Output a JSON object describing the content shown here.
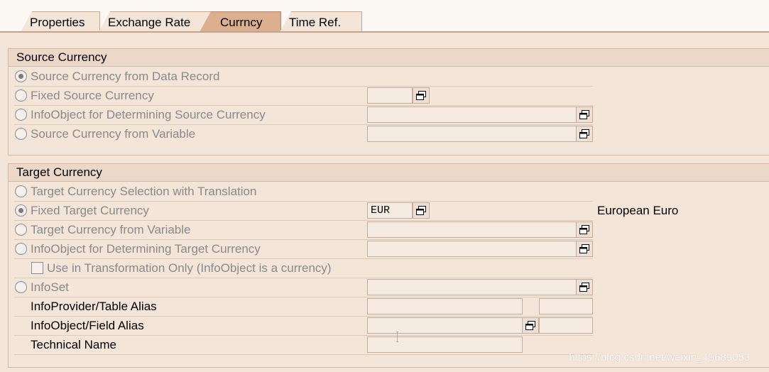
{
  "tabs": [
    {
      "label": "Properties"
    },
    {
      "label": "Exchange Rate"
    },
    {
      "label": "Currncy",
      "active": true
    },
    {
      "label": "Time Ref."
    }
  ],
  "source_currency": {
    "title": "Source Currency",
    "options": [
      {
        "label": "Source Currency from Data Record",
        "selected": true
      },
      {
        "label": "Fixed Source Currency",
        "selected": false,
        "value": ""
      },
      {
        "label": "InfoObject for Determining Source Currency",
        "selected": false,
        "value": ""
      },
      {
        "label": "Source Currency from Variable",
        "selected": false,
        "value": ""
      }
    ]
  },
  "target_currency": {
    "title": "Target Currency",
    "options": [
      {
        "label": "Target Currency Selection with Translation",
        "selected": false
      },
      {
        "label": "Fixed Target Currency",
        "selected": true,
        "value": "EUR",
        "description": "European Euro"
      },
      {
        "label": "Target Currency from Variable",
        "selected": false,
        "value": ""
      },
      {
        "label": "InfoObject for Determining Target Currency",
        "selected": false,
        "value": ""
      }
    ],
    "use_in_transformation": {
      "label": "Use in Transformation Only (InfoObject is a currency)",
      "checked": false
    },
    "infoset": {
      "label": "InfoSet",
      "selected": false,
      "value": ""
    },
    "infoprovider_alias": {
      "label": "InfoProvider/Table Alias",
      "value": "",
      "value2": ""
    },
    "infoobject_alias": {
      "label": "InfoObject/Field Alias",
      "value": "",
      "value2": ""
    },
    "technical_name": {
      "label": "Technical Name",
      "value": ""
    }
  },
  "icons": {
    "value_help": "value-help-icon"
  },
  "colors": {
    "background": "#f3e5d8",
    "active_tab": "#dcb08e",
    "disabled_text": "#8a8a8a"
  },
  "watermark": "https://blog.csdn.net/weixin_45689053"
}
